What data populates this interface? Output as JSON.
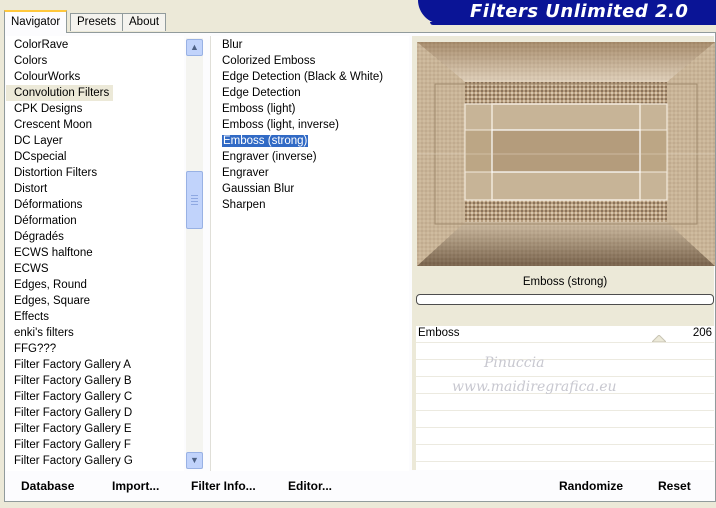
{
  "tabs": [
    "Navigator",
    "Presets",
    "About"
  ],
  "banner": {
    "title": "Filters Unlimited 2.0"
  },
  "categories": [
    "ColorRave",
    "Colors",
    "ColourWorks",
    "Convolution Filters",
    "CPK Designs",
    "Crescent Moon",
    "DC Layer",
    "DCspecial",
    "Distortion Filters",
    "Distort",
    "Déformations",
    "Déformation",
    "Dégradés",
    "ECWS halftone",
    "ECWS",
    "Edges, Round",
    "Edges, Square",
    "Effects",
    "enki's filters",
    "FFG???",
    "Filter Factory Gallery A",
    "Filter Factory Gallery B",
    "Filter Factory Gallery C",
    "Filter Factory Gallery D",
    "Filter Factory Gallery E",
    "Filter Factory Gallery F",
    "Filter Factory Gallery G"
  ],
  "selected_category": "Convolution Filters",
  "filters": [
    "Blur",
    "Colorized Emboss",
    "Edge Detection (Black & White)",
    "Edge Detection",
    "Emboss (light)",
    "Emboss (light, inverse)",
    "Emboss (strong)",
    "Engraver (inverse)",
    "Engraver",
    "Gaussian Blur",
    "Sharpen"
  ],
  "selected_filter": "Emboss (strong)",
  "preview": {
    "filter_name": "Emboss (strong)"
  },
  "parameter": {
    "label": "Emboss",
    "value": "206"
  },
  "watermark": {
    "line1": "Pinuccia",
    "line2": "www.maidiregrafica.eu"
  },
  "buttons": {
    "database": "Database",
    "import": "Import...",
    "filter_info": "Filter Info...",
    "editor": "Editor...",
    "randomize": "Randomize",
    "reset": "Reset"
  },
  "colors": {
    "banner": "#0a1496",
    "selection": "#316ac5",
    "preview_base": "#bea88a"
  }
}
